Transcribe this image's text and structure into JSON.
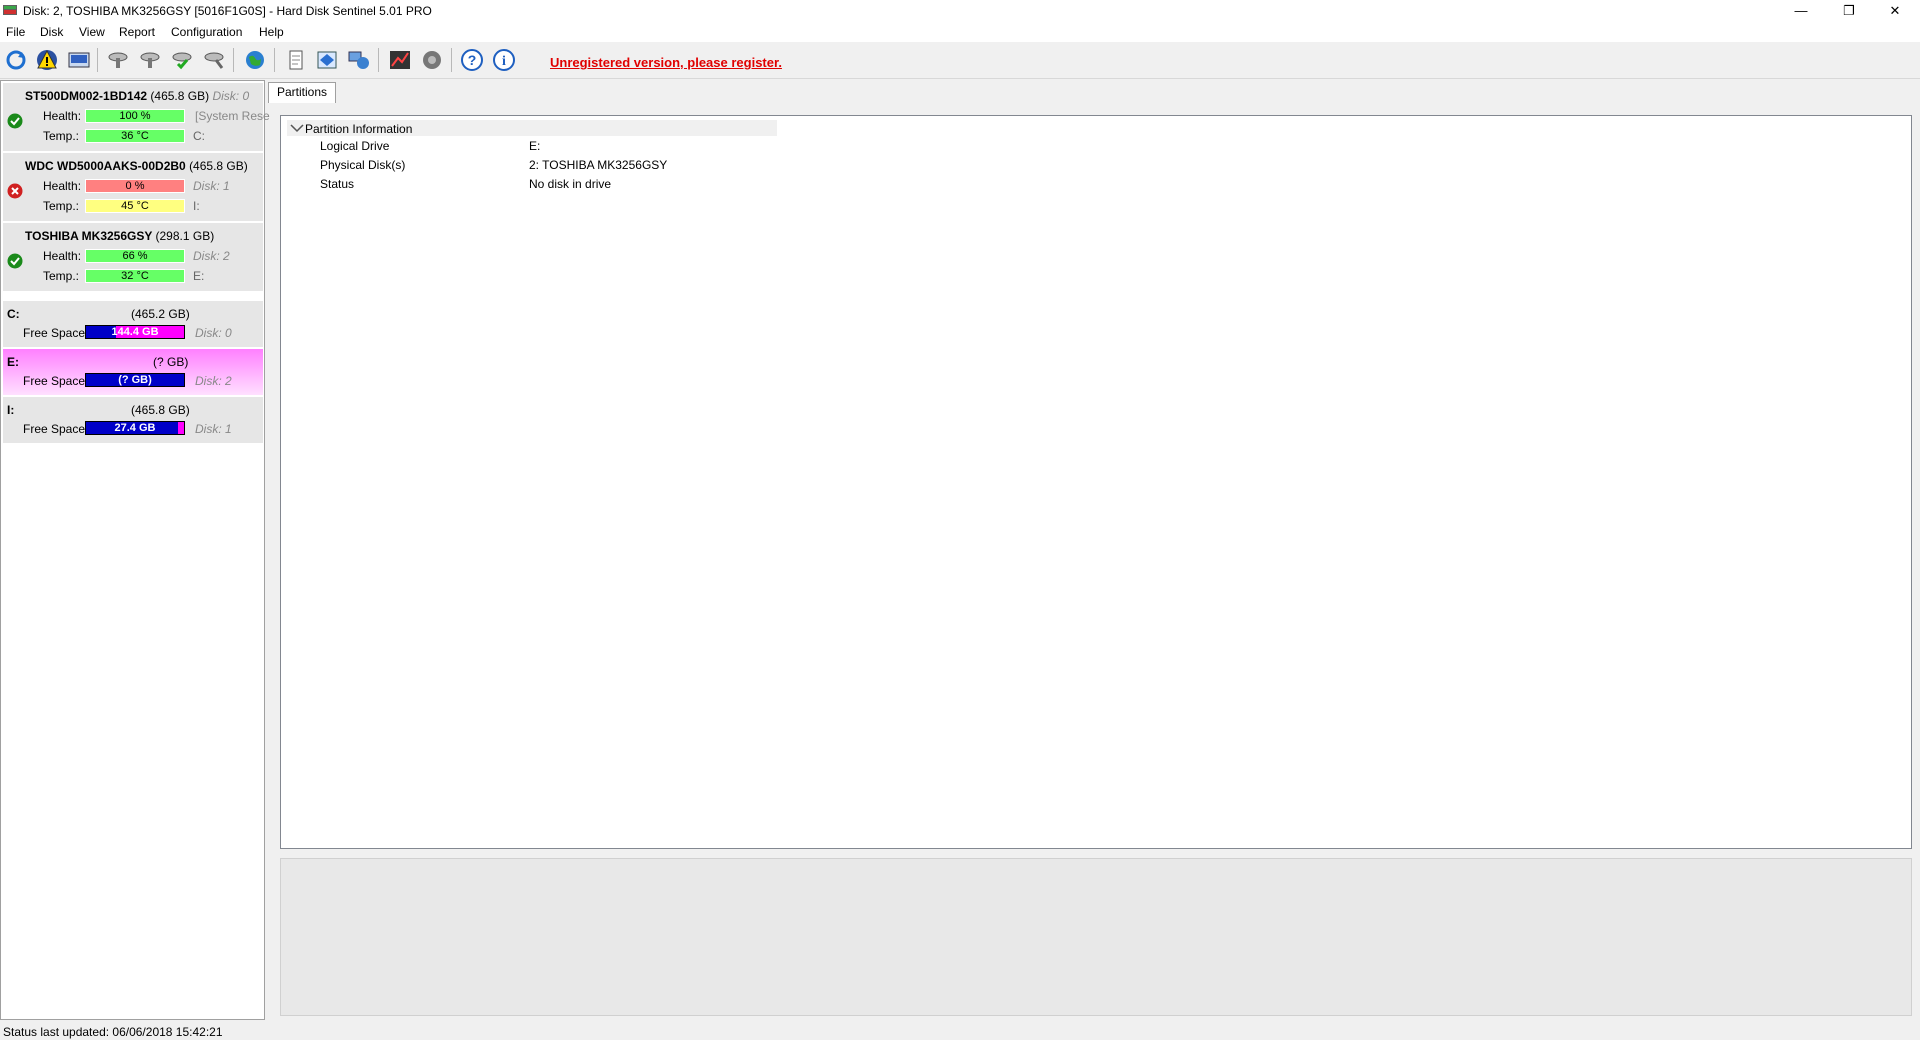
{
  "window": {
    "title": "Disk: 2, TOSHIBA MK3256GSY [5016F1G0S]  -  Hard Disk Sentinel 5.01 PRO",
    "controls": {
      "minimize": "—",
      "restore": "❐",
      "close": "✕"
    }
  },
  "menu": [
    "File",
    "Disk",
    "View",
    "Report",
    "Configuration",
    "Help"
  ],
  "toolbar": {
    "icons": [
      "refresh-icon",
      "warning-icon",
      "disk-info-icon",
      "disk-test-icon",
      "disk-surface-icon",
      "disk-check-icon",
      "disk-tool-icon",
      "web-icon",
      "report-icon",
      "send-report-icon",
      "network-icon",
      "performance-icon",
      "sound-icon",
      "help-icon",
      "about-icon"
    ],
    "register_text": "Unregistered version, please register."
  },
  "disks": [
    {
      "name": "ST500DM002-1BD142",
      "size": "(465.8 GB)",
      "disk_no": "Disk: 0",
      "status": "ok",
      "health_label": "Health:",
      "health": "100 %",
      "health_pct": 100,
      "health_color": "#66ff66",
      "temp_label": "Temp.:",
      "temp": "36 °C",
      "temp_color": "#66ff66",
      "vol1": "[System Rese",
      "vol2": "C:"
    },
    {
      "name": "WDC WD5000AAKS-00D2B0",
      "size": "(465.8 GB)",
      "disk_no": "Disk: 1",
      "status": "error",
      "health_label": "Health:",
      "health": "0 %",
      "health_pct": 0,
      "health_color": "#ff8080",
      "temp_label": "Temp.:",
      "temp": "45 °C",
      "temp_color": "#ffff80",
      "vol1": "Disk: 1",
      "vol2": "I:"
    },
    {
      "name": "TOSHIBA MK3256GSY",
      "size": "(298.1 GB)",
      "disk_no": "Disk: 2",
      "status": "ok",
      "health_label": "Health:",
      "health": "66 %",
      "health_pct": 66,
      "health_color": "#66ff66",
      "temp_label": "Temp.:",
      "temp": "32 °C",
      "temp_color": "#66ff66",
      "vol1": "Disk: 2",
      "vol2": "E:"
    }
  ],
  "partitions": [
    {
      "letter": "C:",
      "size": "(465.2 GB)",
      "free_label": "Free Space",
      "free": "144.4 GB",
      "free_pct": 31,
      "disk": "Disk: 0",
      "selected": false
    },
    {
      "letter": "E:",
      "size": "(? GB)",
      "free_label": "Free Space",
      "free": "(? GB)",
      "free_pct": 100,
      "disk": "Disk: 2",
      "selected": true
    },
    {
      "letter": "I:",
      "size": "(465.8 GB)",
      "free_label": "Free Space",
      "free": "27.4 GB",
      "free_pct": 94,
      "disk": "Disk: 1",
      "selected": false
    }
  ],
  "tabs": [
    "Partitions"
  ],
  "partition_info": {
    "header": "Partition Information",
    "rows": [
      {
        "key": "Logical Drive",
        "value": "E:"
      },
      {
        "key": "Physical Disk(s)",
        "value": "2: TOSHIBA MK3256GSY"
      },
      {
        "key": "Status",
        "value": "No disk in drive"
      }
    ]
  },
  "status_bar": "Status last updated: 06/06/2018 15:42:21"
}
